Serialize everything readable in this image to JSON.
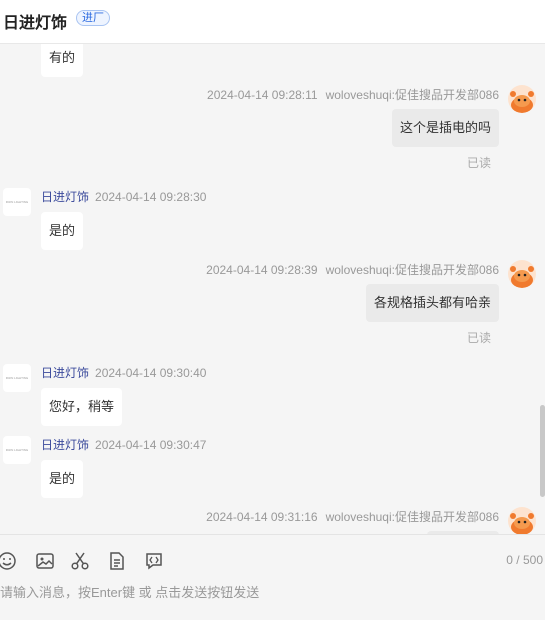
{
  "header": {
    "title": "日进灯饰",
    "badge": "进厂"
  },
  "shop_avatar_text": "RIJIN LIGHTING",
  "messages": [
    {
      "side": "left",
      "text": "有的"
    },
    {
      "side": "right",
      "time": "2024-04-14 09:28:11",
      "sender": "woloveshuqi:促佳搜品开发部086",
      "text": "这个是插电的吗",
      "status": "已读"
    },
    {
      "side": "left",
      "sender": "日进灯饰",
      "time": "2024-04-14 09:28:30",
      "text": "是的"
    },
    {
      "side": "right",
      "time": "2024-04-14 09:28:39",
      "sender": "woloveshuqi:促佳搜品开发部086",
      "text": "各规格插头都有哈亲",
      "status": "已读"
    },
    {
      "side": "left",
      "sender": "日进灯饰",
      "time": "2024-04-14 09:30:40",
      "text": "您好，稍等"
    },
    {
      "side": "left",
      "sender": "日进灯饰",
      "time": "2024-04-14 09:30:47",
      "text": "是的"
    },
    {
      "side": "right",
      "time": "2024-04-14 09:31:16",
      "sender": "woloveshuqi:促佳搜品开发部086"
    }
  ],
  "composer": {
    "counter": "0 / 500",
    "placeholder": "请输入消息，按Enter键 或 点击发送按钮发送",
    "value": ""
  },
  "colors": {
    "accent": "#2d6be0",
    "shop_name": "#3b4a9c",
    "user_avatar": "#f07a2e"
  }
}
